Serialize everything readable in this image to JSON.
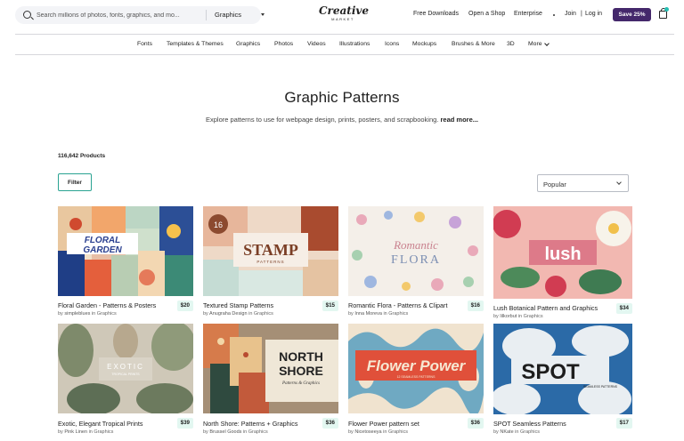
{
  "header": {
    "search_placeholder": "Search millions of photos, fonts, graphics, and mo...",
    "category": "Graphics",
    "logo_line1": "Creative",
    "logo_line2": "MARKET",
    "links": [
      "Free Downloads",
      "Open a Shop",
      "Enterprise",
      "Join",
      "|",
      "Log in"
    ],
    "save_button": "Save 25%"
  },
  "nav": [
    "Fonts",
    "Templates & Themes",
    "Graphics",
    "Photos",
    "Videos",
    "Illustrations",
    "Icons",
    "Mockups",
    "Brushes & More",
    "3D",
    "More"
  ],
  "page": {
    "title": "Graphic Patterns",
    "description": "Explore patterns to use for webpage design, prints, posters, and scrapbooking.",
    "read_more": "read more...",
    "count": "116,642 Products",
    "filter_label": "Filter",
    "sort_value": "Popular"
  },
  "products": [
    {
      "title": "Floral Garden - Patterns & Posters",
      "price": "$20",
      "author": "simpleblues",
      "category": "Graphics",
      "thumb_text": "FLORAL GARDEN"
    },
    {
      "title": "Textured Stamp Patterns",
      "price": "$15",
      "author": "Anugraha Design",
      "category": "Graphics",
      "thumb_text": "STAMP"
    },
    {
      "title": "Romantic Flora - Patterns & Clipart",
      "price": "$16",
      "author": "Inna Moreva",
      "category": "Graphics",
      "thumb_text": "FLORA"
    },
    {
      "title": "Lush Botanical Pattern and Graphics",
      "price": "$34",
      "author": "lilkorbut",
      "category": "Graphics",
      "thumb_text": "lush"
    },
    {
      "title": "Exotic, Elegant Tropical Prints",
      "price": "$39",
      "author": "Pink Linen",
      "category": "Graphics",
      "thumb_text": "EXOTIC"
    },
    {
      "title": "North Shore: Patterns + Graphics",
      "price": "$36",
      "author": "Brussel Goods",
      "category": "Graphics",
      "thumb_text": "NORTH SHORE"
    },
    {
      "title": "Flower Power pattern set",
      "price": "$36",
      "author": "Nicetoseeya",
      "category": "Graphics",
      "thumb_text": "Flower Power"
    },
    {
      "title": "SPOT Seamless Patterns",
      "price": "$17",
      "author": "NKate",
      "category": "Graphics",
      "thumb_text": "SPOT"
    }
  ],
  "by_word": "by",
  "in_word": "in",
  "colors": {
    "accent": "#44286b",
    "teal": "#2aa392",
    "price_bg": "#e3f7f1"
  }
}
